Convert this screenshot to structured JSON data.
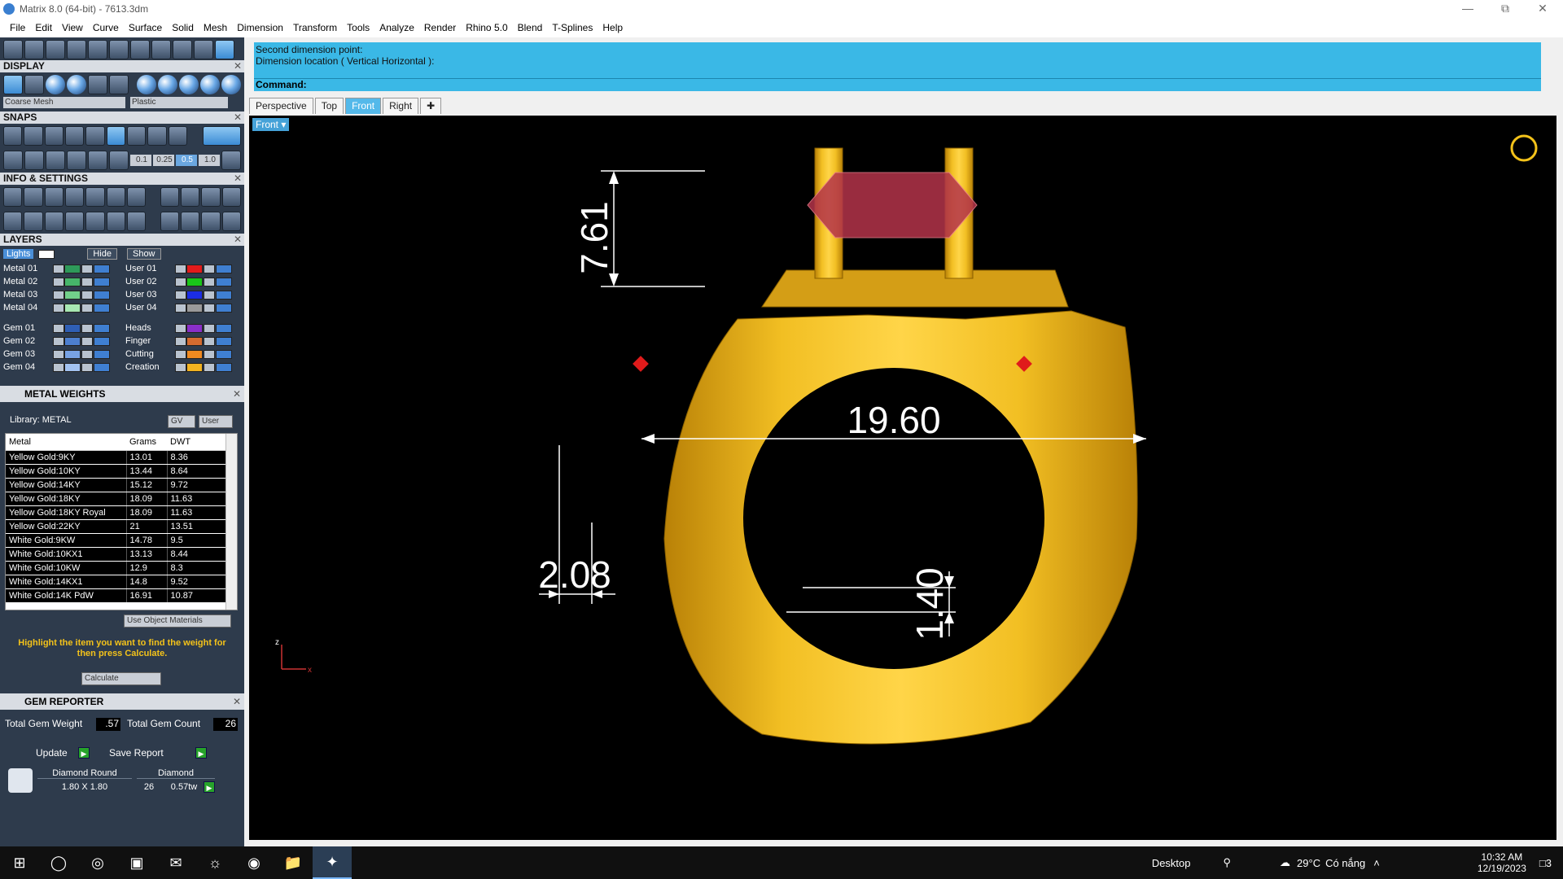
{
  "window": {
    "title": "Matrix 8.0 (64-bit) - 7613.3dm"
  },
  "menu": [
    "File",
    "Edit",
    "View",
    "Curve",
    "Surface",
    "Solid",
    "Mesh",
    "Dimension",
    "Transform",
    "Tools",
    "Analyze",
    "Render",
    "Rhino 5.0",
    "Blend",
    "T-Splines",
    "Help"
  ],
  "panels": {
    "display": {
      "title": "DISPLAY",
      "mesh_combo": "Coarse Mesh",
      "material_combo": "Plastic"
    },
    "snaps": {
      "title": "SNAPS",
      "values": [
        "0.1",
        "0.25",
        "0.5",
        "1.0"
      ]
    },
    "info": {
      "title": "INFO & SETTINGS"
    },
    "layers": {
      "title": "LAYERS",
      "lights_label": "Lights",
      "hide_label": "Hide",
      "show_label": "Show",
      "left": [
        {
          "name": "Metal 01",
          "color": "#2e9a5a"
        },
        {
          "name": "Metal 02",
          "color": "#46b56a"
        },
        {
          "name": "Metal 03",
          "color": "#72d08a"
        },
        {
          "name": "Metal 04",
          "color": "#a7e7b2"
        },
        {
          "name": "Gem 01",
          "color": "#2f5fb5"
        },
        {
          "name": "Gem 02",
          "color": "#4d7fcf"
        },
        {
          "name": "Gem 03",
          "color": "#78a2e3"
        },
        {
          "name": "Gem 04",
          "color": "#a2c2f0"
        }
      ],
      "right": [
        {
          "name": "User 01",
          "color": "#e31b1b"
        },
        {
          "name": "User 02",
          "color": "#19c619"
        },
        {
          "name": "User 03",
          "color": "#1b2de3"
        },
        {
          "name": "User 04",
          "color": "#9a9a9a"
        },
        {
          "name": "Heads",
          "color": "#8a2fc9"
        },
        {
          "name": "Finger",
          "color": "#d46b2f"
        },
        {
          "name": "Cutting",
          "color": "#f08a20"
        },
        {
          "name": "Creation",
          "color": "#f2b320"
        }
      ]
    },
    "metal_weights": {
      "title": "METAL WEIGHTS",
      "library": "Library: METAL",
      "gv_btn": "GV",
      "user_btn": "User",
      "columns": [
        "Metal",
        "Grams",
        "DWT"
      ],
      "rows": [
        [
          "Yellow Gold:9KY",
          "13.01",
          "8.36"
        ],
        [
          "Yellow Gold:10KY",
          "13.44",
          "8.64"
        ],
        [
          "Yellow Gold:14KY",
          "15.12",
          "9.72"
        ],
        [
          "Yellow Gold:18KY",
          "18.09",
          "11.63"
        ],
        [
          "Yellow Gold:18KY Royal",
          "18.09",
          "11.63"
        ],
        [
          "Yellow Gold:22KY",
          "21",
          "13.51"
        ],
        [
          "White Gold:9KW",
          "14.78",
          "9.5"
        ],
        [
          "White Gold:10KX1",
          "13.13",
          "8.44"
        ],
        [
          "White Gold:10KW",
          "12.9",
          "8.3"
        ],
        [
          "White Gold:14KX1",
          "14.8",
          "9.52"
        ],
        [
          "White Gold:14K PdW",
          "16.91",
          "10.87"
        ]
      ],
      "use_object_materials": "Use Object Materials",
      "hint": "Highlight the item you want to find the weight for then press Calculate.",
      "calculate": "Calculate"
    },
    "gem_reporter": {
      "title": "GEM REPORTER",
      "total_weight_label": "Total Gem Weight",
      "total_weight": ".57",
      "total_count_label": "Total Gem Count",
      "total_count": "26",
      "update": "Update",
      "save_report": "Save Report",
      "gem_shape": "Diamond Round",
      "gem_size": "1.80 X 1.80",
      "gem_type": "Diamond",
      "gem_count": "26",
      "gem_tw": "0.57tw"
    }
  },
  "command": {
    "line1": "Second dimension point:",
    "line2": "Dimension location ( Vertical  Horizontal ):",
    "prompt": "Command:"
  },
  "tabs": [
    "Perspective",
    "Top",
    "Front",
    "Right"
  ],
  "active_tab": "Front",
  "viewport": {
    "label": "Front",
    "dimensions": {
      "height": "7.61",
      "inner_diameter": "19.60",
      "bottom_left": "2.08",
      "bottom_right": "1.40"
    },
    "axis": {
      "z": "z",
      "x": "x"
    },
    "gold_color": "#e9b21a"
  },
  "taskbar": {
    "desktop": "Desktop",
    "weather": "29°C",
    "weather_text": "Có nắng",
    "time": "10:32 AM",
    "date": "12/19/2023",
    "notif": "3"
  }
}
